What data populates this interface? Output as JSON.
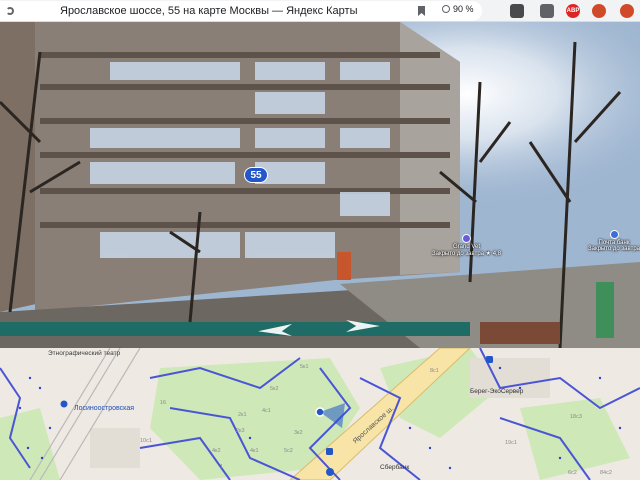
{
  "browser": {
    "tab_title": "Ярославское шоссе, 55 на карте Москвы — Яндекс Карты",
    "zoom_level": "90 %",
    "extensions": [
      {
        "name": "extension-1"
      },
      {
        "name": "extension-2"
      },
      {
        "name": "adblock-plus",
        "label": "ABP"
      },
      {
        "name": "extension-4"
      },
      {
        "name": "extension-5"
      }
    ]
  },
  "panorama": {
    "house_number": "55",
    "pois": [
      {
        "name": "Grand Vet",
        "status": "Закрыто до завтра ★ 4,8"
      },
      {
        "name": "Почта банк",
        "status": "Закрыто до завтра"
      }
    ]
  },
  "map": {
    "labels": {
      "theatre": "Этнографический театр",
      "station": "Лосиноостровская",
      "highway": "Ярославское ш.",
      "perekrestok": "Берег-ЭкоСервер",
      "sber": "Сбербанк"
    },
    "house_numbers": [
      "5к2",
      "5к1",
      "2к1",
      "4с1",
      "3к2",
      "4к1",
      "10с1",
      "1",
      "8с1",
      "19с1",
      "18с3",
      "84с2",
      "6с2",
      "5с2",
      "2к3",
      "4к2",
      "16"
    ]
  },
  "colors": {
    "route_line": "#4a55d6",
    "badge": "#2357c9",
    "poi": "#6b5bd4"
  }
}
